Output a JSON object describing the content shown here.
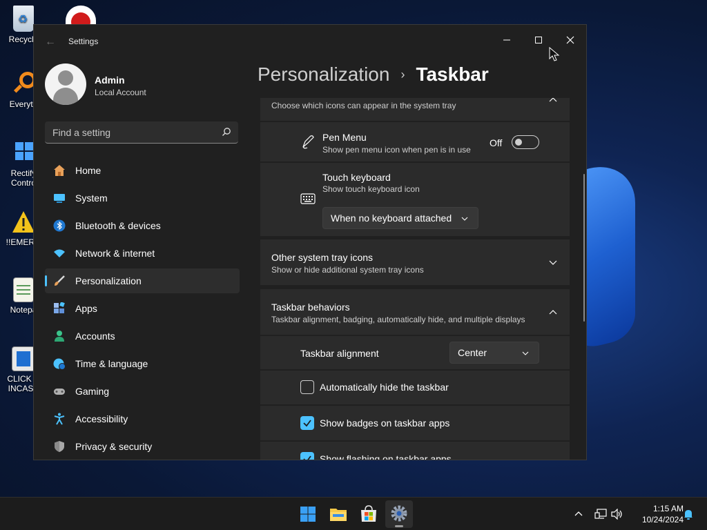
{
  "desktop": {
    "icons": [
      {
        "label": "Recycle"
      },
      {
        "label": "Everyth"
      },
      {
        "label": "Rectify",
        "label2": "Contro"
      },
      {
        "label": "!!EMERG"
      },
      {
        "label": "Notepa"
      },
      {
        "label": "CLICK H",
        "label2": "INCASE"
      }
    ]
  },
  "window": {
    "title": "Settings",
    "back_icon": "arrow-left-icon",
    "controls": [
      "minimize-icon",
      "maximize-icon",
      "close-icon"
    ]
  },
  "profile": {
    "name": "Admin",
    "type": "Local Account"
  },
  "search": {
    "placeholder": "Find a setting"
  },
  "nav": {
    "items": [
      {
        "label": "Home",
        "icon": "home-icon",
        "color": "#e8a15a"
      },
      {
        "label": "System",
        "icon": "monitor-icon",
        "color": "#4cc2ff"
      },
      {
        "label": "Bluetooth & devices",
        "icon": "bluetooth-icon",
        "color": "#1f78d1"
      },
      {
        "label": "Network & internet",
        "icon": "wifi-icon",
        "color": "#4cc2ff"
      },
      {
        "label": "Personalization",
        "icon": "brush-icon",
        "color": "#e8a15a",
        "active": true
      },
      {
        "label": "Apps",
        "icon": "apps-icon",
        "color": "#7aa7e8"
      },
      {
        "label": "Accounts",
        "icon": "person-icon",
        "color": "#3bc48b"
      },
      {
        "label": "Time & language",
        "icon": "globe-clock-icon",
        "color": "#4cc2ff"
      },
      {
        "label": "Gaming",
        "icon": "gamepad-icon",
        "color": "#b0b0b0"
      },
      {
        "label": "Accessibility",
        "icon": "accessibility-icon",
        "color": "#4cc2ff"
      },
      {
        "label": "Privacy & security",
        "icon": "shield-icon",
        "color": "#a8a8a8"
      }
    ]
  },
  "breadcrumb": {
    "parent": "Personalization",
    "separator": "›",
    "current": "Taskbar"
  },
  "tray_section": {
    "subtitle": "Choose which icons can appear in the system tray"
  },
  "pen_menu": {
    "title": "Pen Menu",
    "subtitle": "Show pen menu icon when pen is in use",
    "state": "Off"
  },
  "touch_keyboard": {
    "title": "Touch keyboard",
    "subtitle": "Show touch keyboard icon",
    "dropdown": "When no keyboard attached"
  },
  "other_tray": {
    "title": "Other system tray icons",
    "subtitle": "Show or hide additional system tray icons"
  },
  "behaviors": {
    "title": "Taskbar behaviors",
    "subtitle": "Taskbar alignment, badging, automatically hide, and multiple displays",
    "alignment_label": "Taskbar alignment",
    "alignment_value": "Center",
    "auto_hide": "Automatically hide the taskbar",
    "badges": "Show badges on taskbar apps",
    "flashing": "Show flashing on taskbar apps"
  },
  "taskbar": {
    "apps": [
      "windows-start-icon",
      "file-explorer-icon",
      "microsoft-store-icon",
      "settings-gear-icon"
    ],
    "time": "1:15 AM",
    "date": "10/24/2024"
  }
}
